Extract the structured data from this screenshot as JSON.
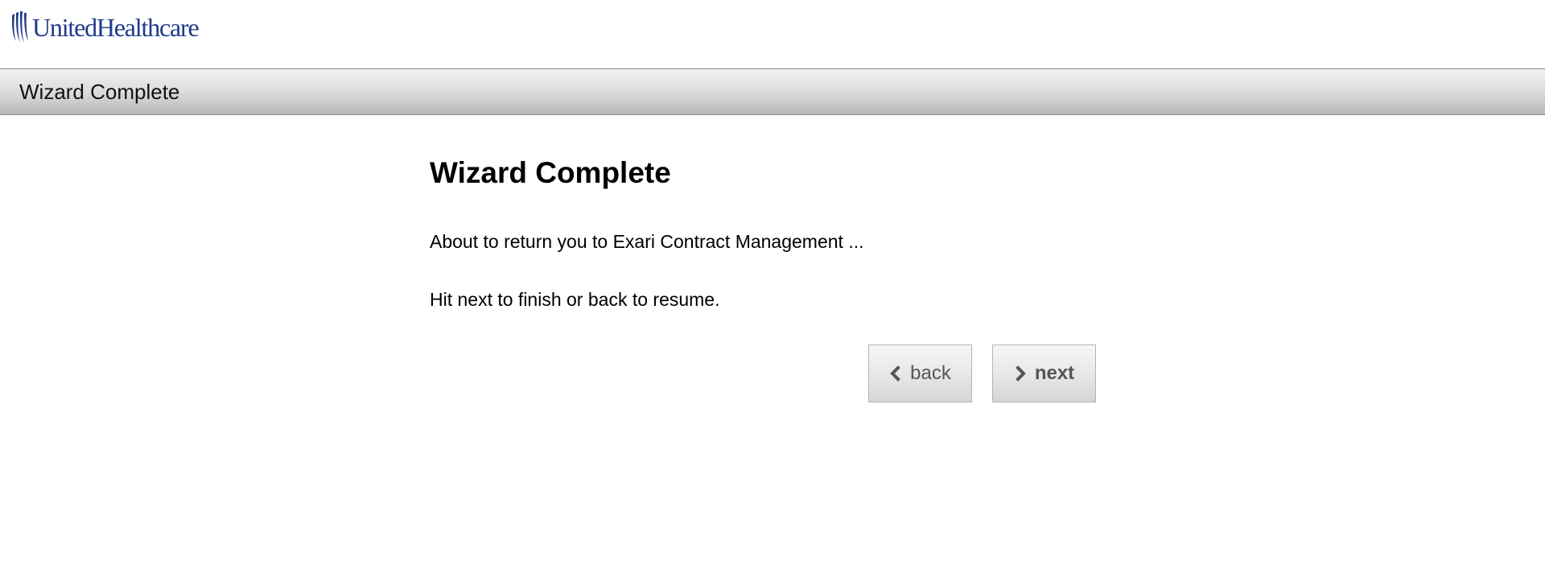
{
  "header": {
    "logo_text": "UnitedHealthcare",
    "brand_color": "#1f3a8a"
  },
  "titlebar": {
    "title": "Wizard Complete"
  },
  "main": {
    "heading": "Wizard Complete",
    "message": "About to return you to Exari Contract Management ...",
    "instruction": "Hit next to finish or back to resume."
  },
  "buttons": {
    "back_label": "back",
    "back_icon": "chevron-left-icon",
    "next_label": "next",
    "next_icon": "chevron-right-icon"
  }
}
